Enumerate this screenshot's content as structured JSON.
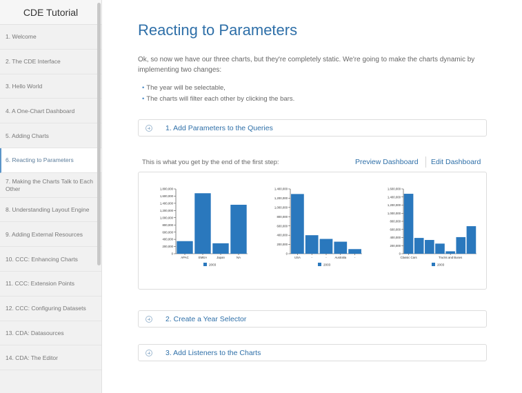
{
  "sidebar": {
    "title": "CDE Tutorial",
    "items": [
      {
        "label": "1. Welcome"
      },
      {
        "label": "2. The CDE Interface"
      },
      {
        "label": "3. Hello World"
      },
      {
        "label": "4. A One-Chart Dashboard"
      },
      {
        "label": "5. Adding Charts"
      },
      {
        "label": "6. Reacting to Parameters",
        "active": true
      },
      {
        "label": "7. Making the Charts Talk to Each Other"
      },
      {
        "label": "8. Understanding Layout Engine"
      },
      {
        "label": "9. Adding External Resources"
      },
      {
        "label": "10. CCC: Enhancing Charts"
      },
      {
        "label": "11. CCC: Extension Points"
      },
      {
        "label": "12. CCC: Configuring Datasets"
      },
      {
        "label": "13. CDA: Datasources"
      },
      {
        "label": "14. CDA: The Editor"
      }
    ]
  },
  "main": {
    "title": "Reacting to Parameters",
    "intro": "Ok, so now we have our three charts, but they're completely static. We're going to make the charts dynamic by implementing two changes:",
    "bullets": [
      "The year will be selectable,",
      "The charts will filter each other by clicking the bars."
    ],
    "sections": [
      {
        "label": "1. Add Parameters to the Queries"
      },
      {
        "label": "2. Create a Year Selector"
      },
      {
        "label": "3. Add Listeners to the Charts"
      }
    ],
    "step_caption": "This is what you get by the end of the first step:",
    "preview_link": "Preview Dashboard",
    "edit_link": "Edit Dashboard"
  },
  "colors": {
    "accent": "#2e6fa8",
    "bar": "#2a78bd"
  },
  "chart_data": [
    {
      "type": "bar",
      "title": "",
      "categories": [
        "APAC",
        "EMEA",
        "Japan",
        "NA"
      ],
      "x_tick_labels": [
        "APAC",
        "EMEA",
        "Japan",
        "NA"
      ],
      "series": [
        {
          "name": "2003",
          "values": [
            350000,
            1680000,
            290000,
            1360000
          ]
        }
      ],
      "ylim": [
        0,
        1800000
      ],
      "y_ticks": [
        0,
        200000,
        400000,
        600000,
        800000,
        1000000,
        1200000,
        1400000,
        1600000,
        1800000
      ],
      "y_tick_labels": [
        "0",
        "200,000",
        "400,000",
        "600,000",
        "800,000",
        "1,000,000",
        "1,200,000",
        "1,400,000",
        "1,600,000",
        "1,800,000"
      ],
      "legend": "bottom"
    },
    {
      "type": "bar",
      "title": "",
      "categories": [
        "USA",
        "",
        "",
        "Australia",
        ""
      ],
      "x_tick_labels": [
        "USA",
        "-",
        "-",
        "Australia",
        "-"
      ],
      "series": [
        {
          "name": "2003",
          "values": [
            1290000,
            400000,
            320000,
            260000,
            100000
          ]
        }
      ],
      "ylim": [
        0,
        1400000
      ],
      "y_ticks": [
        0,
        200000,
        400000,
        600000,
        800000,
        1000000,
        1200000,
        1400000
      ],
      "y_tick_labels": [
        "0",
        "200,000",
        "400,000",
        "600,000",
        "800,000",
        "1,000,000",
        "1,200,000",
        "1,400,000"
      ],
      "legend": "bottom"
    },
    {
      "type": "bar",
      "title": "",
      "categories": [
        "Classic Cars",
        "",
        "",
        "",
        "Trucks and Buses",
        "",
        ""
      ],
      "x_tick_labels": [
        "Classic Cars",
        "",
        "",
        "",
        "Trucks and Buses",
        "",
        ""
      ],
      "series": [
        {
          "name": "2003",
          "values": [
            1480000,
            390000,
            340000,
            250000,
            60000,
            410000,
            680000
          ]
        }
      ],
      "ylim": [
        0,
        1600000
      ],
      "y_ticks": [
        0,
        200000,
        400000,
        600000,
        800000,
        1000000,
        1200000,
        1400000,
        1600000
      ],
      "y_tick_labels": [
        "0",
        "200,000",
        "400,000",
        "600,000",
        "800,000",
        "1,000,000",
        "1,200,000",
        "1,400,000",
        "1,600,000"
      ],
      "legend": "bottom"
    }
  ]
}
